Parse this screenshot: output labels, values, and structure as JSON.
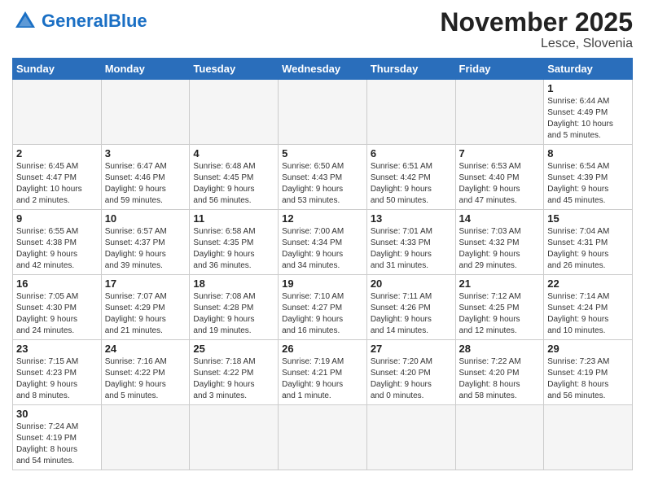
{
  "header": {
    "logo_general": "General",
    "logo_blue": "Blue",
    "month_title": "November 2025",
    "location": "Lesce, Slovenia"
  },
  "days_of_week": [
    "Sunday",
    "Monday",
    "Tuesday",
    "Wednesday",
    "Thursday",
    "Friday",
    "Saturday"
  ],
  "weeks": [
    [
      {
        "day": "",
        "info": "",
        "empty": true
      },
      {
        "day": "",
        "info": "",
        "empty": true
      },
      {
        "day": "",
        "info": "",
        "empty": true
      },
      {
        "day": "",
        "info": "",
        "empty": true
      },
      {
        "day": "",
        "info": "",
        "empty": true
      },
      {
        "day": "",
        "info": "",
        "empty": true
      },
      {
        "day": "1",
        "info": "Sunrise: 6:44 AM\nSunset: 4:49 PM\nDaylight: 10 hours\nand 5 minutes."
      }
    ],
    [
      {
        "day": "2",
        "info": "Sunrise: 6:45 AM\nSunset: 4:47 PM\nDaylight: 10 hours\nand 2 minutes."
      },
      {
        "day": "3",
        "info": "Sunrise: 6:47 AM\nSunset: 4:46 PM\nDaylight: 9 hours\nand 59 minutes."
      },
      {
        "day": "4",
        "info": "Sunrise: 6:48 AM\nSunset: 4:45 PM\nDaylight: 9 hours\nand 56 minutes."
      },
      {
        "day": "5",
        "info": "Sunrise: 6:50 AM\nSunset: 4:43 PM\nDaylight: 9 hours\nand 53 minutes."
      },
      {
        "day": "6",
        "info": "Sunrise: 6:51 AM\nSunset: 4:42 PM\nDaylight: 9 hours\nand 50 minutes."
      },
      {
        "day": "7",
        "info": "Sunrise: 6:53 AM\nSunset: 4:40 PM\nDaylight: 9 hours\nand 47 minutes."
      },
      {
        "day": "8",
        "info": "Sunrise: 6:54 AM\nSunset: 4:39 PM\nDaylight: 9 hours\nand 45 minutes."
      }
    ],
    [
      {
        "day": "9",
        "info": "Sunrise: 6:55 AM\nSunset: 4:38 PM\nDaylight: 9 hours\nand 42 minutes."
      },
      {
        "day": "10",
        "info": "Sunrise: 6:57 AM\nSunset: 4:37 PM\nDaylight: 9 hours\nand 39 minutes."
      },
      {
        "day": "11",
        "info": "Sunrise: 6:58 AM\nSunset: 4:35 PM\nDaylight: 9 hours\nand 36 minutes."
      },
      {
        "day": "12",
        "info": "Sunrise: 7:00 AM\nSunset: 4:34 PM\nDaylight: 9 hours\nand 34 minutes."
      },
      {
        "day": "13",
        "info": "Sunrise: 7:01 AM\nSunset: 4:33 PM\nDaylight: 9 hours\nand 31 minutes."
      },
      {
        "day": "14",
        "info": "Sunrise: 7:03 AM\nSunset: 4:32 PM\nDaylight: 9 hours\nand 29 minutes."
      },
      {
        "day": "15",
        "info": "Sunrise: 7:04 AM\nSunset: 4:31 PM\nDaylight: 9 hours\nand 26 minutes."
      }
    ],
    [
      {
        "day": "16",
        "info": "Sunrise: 7:05 AM\nSunset: 4:30 PM\nDaylight: 9 hours\nand 24 minutes."
      },
      {
        "day": "17",
        "info": "Sunrise: 7:07 AM\nSunset: 4:29 PM\nDaylight: 9 hours\nand 21 minutes."
      },
      {
        "day": "18",
        "info": "Sunrise: 7:08 AM\nSunset: 4:28 PM\nDaylight: 9 hours\nand 19 minutes."
      },
      {
        "day": "19",
        "info": "Sunrise: 7:10 AM\nSunset: 4:27 PM\nDaylight: 9 hours\nand 16 minutes."
      },
      {
        "day": "20",
        "info": "Sunrise: 7:11 AM\nSunset: 4:26 PM\nDaylight: 9 hours\nand 14 minutes."
      },
      {
        "day": "21",
        "info": "Sunrise: 7:12 AM\nSunset: 4:25 PM\nDaylight: 9 hours\nand 12 minutes."
      },
      {
        "day": "22",
        "info": "Sunrise: 7:14 AM\nSunset: 4:24 PM\nDaylight: 9 hours\nand 10 minutes."
      }
    ],
    [
      {
        "day": "23",
        "info": "Sunrise: 7:15 AM\nSunset: 4:23 PM\nDaylight: 9 hours\nand 8 minutes."
      },
      {
        "day": "24",
        "info": "Sunrise: 7:16 AM\nSunset: 4:22 PM\nDaylight: 9 hours\nand 5 minutes."
      },
      {
        "day": "25",
        "info": "Sunrise: 7:18 AM\nSunset: 4:22 PM\nDaylight: 9 hours\nand 3 minutes."
      },
      {
        "day": "26",
        "info": "Sunrise: 7:19 AM\nSunset: 4:21 PM\nDaylight: 9 hours\nand 1 minute."
      },
      {
        "day": "27",
        "info": "Sunrise: 7:20 AM\nSunset: 4:20 PM\nDaylight: 9 hours\nand 0 minutes."
      },
      {
        "day": "28",
        "info": "Sunrise: 7:22 AM\nSunset: 4:20 PM\nDaylight: 8 hours\nand 58 minutes."
      },
      {
        "day": "29",
        "info": "Sunrise: 7:23 AM\nSunset: 4:19 PM\nDaylight: 8 hours\nand 56 minutes."
      }
    ],
    [
      {
        "day": "30",
        "info": "Sunrise: 7:24 AM\nSunset: 4:19 PM\nDaylight: 8 hours\nand 54 minutes."
      },
      {
        "day": "",
        "info": "",
        "empty": true
      },
      {
        "day": "",
        "info": "",
        "empty": true
      },
      {
        "day": "",
        "info": "",
        "empty": true
      },
      {
        "day": "",
        "info": "",
        "empty": true
      },
      {
        "day": "",
        "info": "",
        "empty": true
      },
      {
        "day": "",
        "info": "",
        "empty": true
      }
    ]
  ]
}
